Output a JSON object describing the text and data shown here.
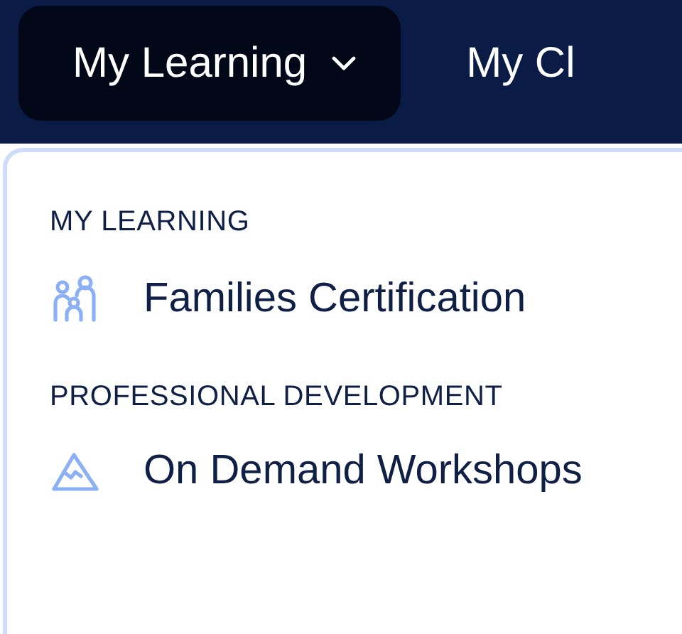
{
  "nav": {
    "items": [
      {
        "label": "My Learning",
        "selected": true,
        "dropdown": true
      },
      {
        "label": "My Cl",
        "selected": false,
        "dropdown": false
      }
    ]
  },
  "menu": {
    "sections": [
      {
        "heading": "MY LEARNING",
        "items": [
          {
            "label": "Families Certification",
            "kind": "family"
          }
        ]
      },
      {
        "heading": "PROFESSIONAL DEVELOPMENT",
        "items": [
          {
            "label": "On Demand Workshops",
            "kind": "mountain"
          }
        ]
      }
    ]
  }
}
